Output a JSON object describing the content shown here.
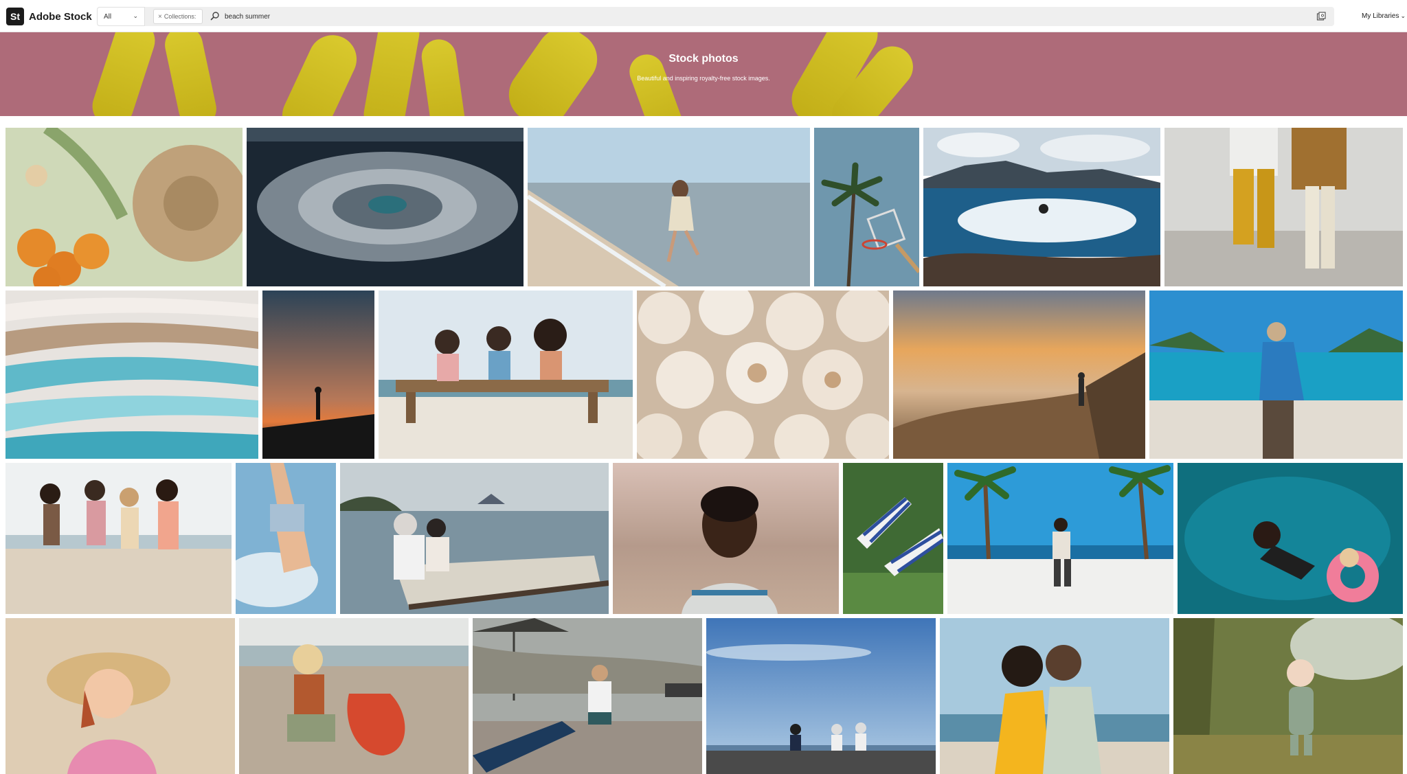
{
  "brand": {
    "mark": "St",
    "name": "Adobe Stock"
  },
  "search": {
    "scope": "All",
    "chip_label": "Collections:",
    "query": "beach summer"
  },
  "header": {
    "libraries": "My Libraries"
  },
  "hero": {
    "title": "Stock photos",
    "subtitle": "Beautiful and inspiring royalty-free stock images."
  },
  "icons": {
    "search": "search-icon",
    "visual_search": "visual-search-icon",
    "clear": "close-icon",
    "dropdown": "chevron-down-icon"
  },
  "colors": {
    "hero_background": "#ae6b79",
    "brand_dark": "#1b1b1b",
    "search_background": "#efefef"
  }
}
